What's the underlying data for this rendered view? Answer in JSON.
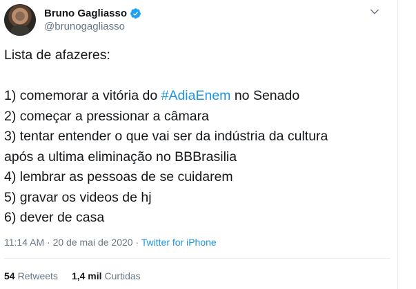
{
  "author": {
    "display_name": "Bruno Gagliasso",
    "handle": "@brunogagliasso",
    "verified": true,
    "avatar_icon": "avatar-photo"
  },
  "tweet": {
    "lines": [
      {
        "text": "Lista de afazeres:"
      },
      {
        "text": ""
      },
      {
        "pre": "1) comemorar a vitória do ",
        "hashtag": "#AdiaEnem",
        "post": " no Senado"
      },
      {
        "text": "2) começar a pressionar a câmara"
      },
      {
        "text": "3) tentar entender o que vai ser da indústria da cultura"
      },
      {
        "text": "após a ultima eliminação no BBBrasilia"
      },
      {
        "text": "4) lembrar as pessoas de se cuidarem"
      },
      {
        "text": "5) gravar os videos de hj"
      },
      {
        "text": "6) dever de casa"
      }
    ],
    "time": "11:14 AM",
    "separator": " · ",
    "date": "20 de mai de 2020",
    "source": "Twitter for iPhone"
  },
  "stats": {
    "retweets_count": "54",
    "retweets_label": "Retweets",
    "likes_count": "1,4 mil",
    "likes_label": "Curtidas"
  },
  "colors": {
    "link": "#1b95e0",
    "secondary": "#657786",
    "text": "#14171a",
    "border": "#e6ecf0",
    "verified": "#1da1f2"
  }
}
